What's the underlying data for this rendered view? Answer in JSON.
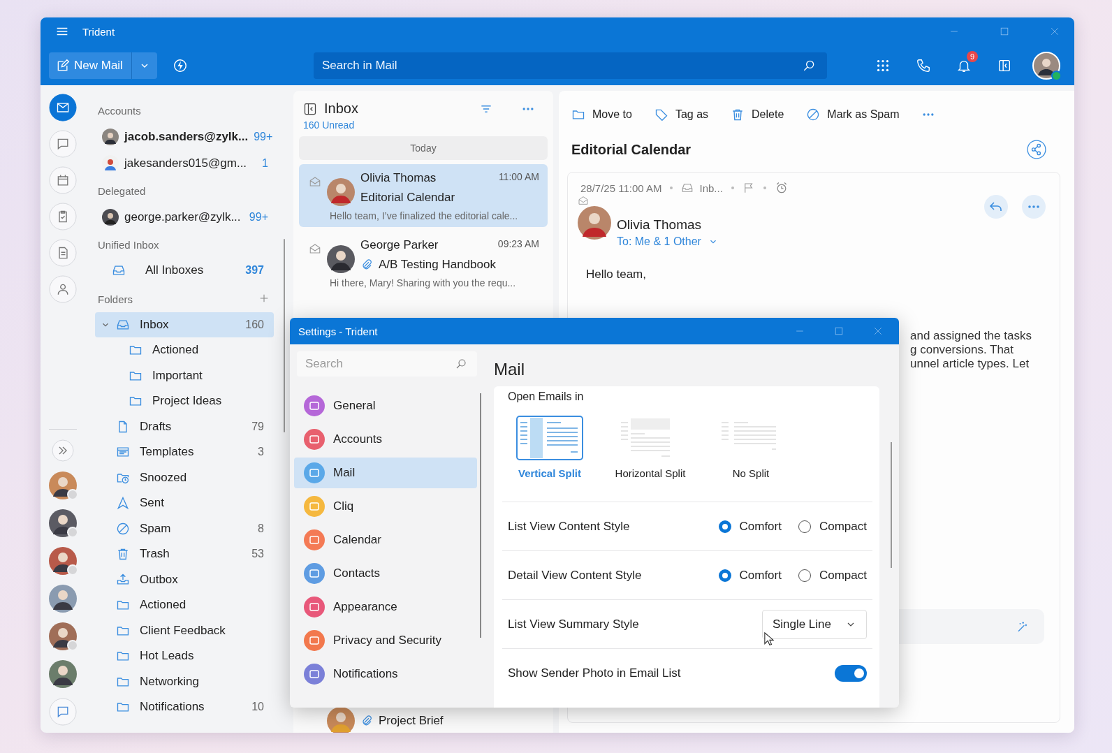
{
  "window": {
    "title": "Trident"
  },
  "toolbar": {
    "new_mail": "New Mail",
    "search": {
      "placeholder": "Search in Mail"
    },
    "notification_count": "9"
  },
  "rail": {
    "items": [
      {
        "kind": "mail",
        "selected": true
      },
      {
        "kind": "chat",
        "selected": false
      },
      {
        "kind": "calendar",
        "selected": false
      },
      {
        "kind": "tasks",
        "selected": false
      },
      {
        "kind": "notes",
        "selected": false
      },
      {
        "kind": "contacts",
        "selected": false
      }
    ],
    "contacts": [
      {
        "status_dot": true
      },
      {
        "status_dot": true
      },
      {
        "status_dot": true
      },
      {
        "status_dot": false
      },
      {
        "status_dot": true
      },
      {
        "status_dot": false
      }
    ]
  },
  "accounts": {
    "heading": "Accounts",
    "items": [
      {
        "name": "jacob.sanders@zylk...",
        "count": "99+",
        "unread": true
      },
      {
        "name": "jakesanders015@gm...",
        "count": "1",
        "unread": false
      }
    ]
  },
  "delegated": {
    "heading": "Delegated",
    "items": [
      {
        "name": "george.parker@zylk...",
        "count": "99+",
        "unread": false
      }
    ]
  },
  "unified": {
    "heading": "Unified Inbox",
    "items": [
      {
        "name": "All Inboxes",
        "count": "397"
      }
    ]
  },
  "folders": {
    "heading": "Folders",
    "items": [
      {
        "name": "Inbox",
        "count": "160",
        "kind": "inbox",
        "selected": true,
        "expanded": true,
        "children": [
          {
            "name": "Actioned",
            "kind": "folder",
            "selected": false
          },
          {
            "name": "Important",
            "kind": "folder",
            "selected": false
          },
          {
            "name": "Project Ideas",
            "kind": "folder",
            "selected": false
          }
        ]
      },
      {
        "name": "Drafts",
        "count": "79",
        "kind": "drafts",
        "selected": false
      },
      {
        "name": "Templates",
        "count": "3",
        "kind": "templates",
        "selected": false
      },
      {
        "name": "Snoozed",
        "kind": "snoozed",
        "selected": false
      },
      {
        "name": "Sent",
        "kind": "sent",
        "selected": false
      },
      {
        "name": "Spam",
        "count": "8",
        "kind": "spam",
        "selected": false
      },
      {
        "name": "Trash",
        "count": "53",
        "kind": "trash",
        "selected": false
      },
      {
        "name": "Outbox",
        "kind": "outbox",
        "selected": false
      },
      {
        "name": "Actioned",
        "kind": "folder",
        "selected": false
      },
      {
        "name": "Client Feedback",
        "kind": "folder",
        "selected": false
      },
      {
        "name": "Hot Leads",
        "kind": "folder",
        "selected": false
      },
      {
        "name": "Networking",
        "kind": "folder",
        "selected": false
      },
      {
        "name": "Notifications",
        "count": "10",
        "kind": "folder",
        "selected": false
      }
    ]
  },
  "mail_list": {
    "title": "Inbox",
    "unread": "160 Unread",
    "group": "Today",
    "messages": [
      {
        "sender": "Olivia Thomas",
        "time": "11:00 AM",
        "subject": "Editorial Calendar",
        "preview": "Hello team, I’ve finalized the editorial cale...",
        "selected": true,
        "attachment": false
      },
      {
        "sender": "George Parker",
        "time": "09:23 AM",
        "subject": "A/B Testing Handbook",
        "preview": "Hi there, Mary! Sharing with you the requ...",
        "selected": false,
        "attachment": true
      }
    ],
    "partial_message": {
      "subject": "Project Brief",
      "attachment": true
    }
  },
  "reading": {
    "actions": [
      {
        "label": "Move to",
        "kind": "move"
      },
      {
        "label": "Tag as",
        "kind": "tag"
      },
      {
        "label": "Delete",
        "kind": "delete"
      },
      {
        "label": "Mark as Spam",
        "kind": "spam"
      }
    ],
    "subject": "Editorial Calendar",
    "date": "28/7/25 11:00 AM",
    "folder": "Inb...",
    "sender": "Olivia Thomas",
    "recipients": "To: Me & 1 Other",
    "greeting": "Hello team,",
    "body_lines": [
      "and assigned the tasks",
      "g conversions. That",
      "unnel article types. Let"
    ]
  },
  "settings": {
    "title": "Settings - Trident",
    "search": {
      "placeholder": "Search"
    },
    "nav": [
      {
        "label": "General",
        "color": "#b567d8",
        "selected": false
      },
      {
        "label": "Accounts",
        "color": "#e8606e",
        "selected": false
      },
      {
        "label": "Mail",
        "color": "#5aa8e8",
        "selected": true
      },
      {
        "label": "Cliq",
        "color": "#f5b83f",
        "selected": false
      },
      {
        "label": "Calendar",
        "color": "#f47a55",
        "selected": false
      },
      {
        "label": "Contacts",
        "color": "#5e9ce2",
        "selected": false
      },
      {
        "label": "Appearance",
        "color": "#e8587a",
        "selected": false
      },
      {
        "label": "Privacy and Security",
        "color": "#f2784d",
        "selected": false
      },
      {
        "label": "Notifications",
        "color": "#7b80d8",
        "selected": false
      }
    ],
    "heading": "Mail",
    "open_emails": {
      "label": "Open Emails in",
      "options": [
        {
          "label": "Vertical Split",
          "kind": "vertical",
          "selected": true
        },
        {
          "label": "Horizontal Split",
          "kind": "horizontal",
          "selected": false
        },
        {
          "label": "No Split",
          "kind": "none",
          "selected": false
        }
      ]
    },
    "rows": [
      {
        "kind": "radio",
        "label": "List View Content Style",
        "options": [
          {
            "label": "Comfort",
            "selected": true
          },
          {
            "label": "Compact",
            "selected": false
          }
        ]
      },
      {
        "kind": "radio",
        "label": "Detail View Content Style",
        "options": [
          {
            "label": "Comfort",
            "selected": true
          },
          {
            "label": "Compact",
            "selected": false
          }
        ]
      },
      {
        "kind": "dropdown",
        "label": "List View Summary Style",
        "value": "Single Line"
      },
      {
        "kind": "toggle",
        "label": "Show Sender Photo in Email List",
        "on": true
      }
    ]
  }
}
